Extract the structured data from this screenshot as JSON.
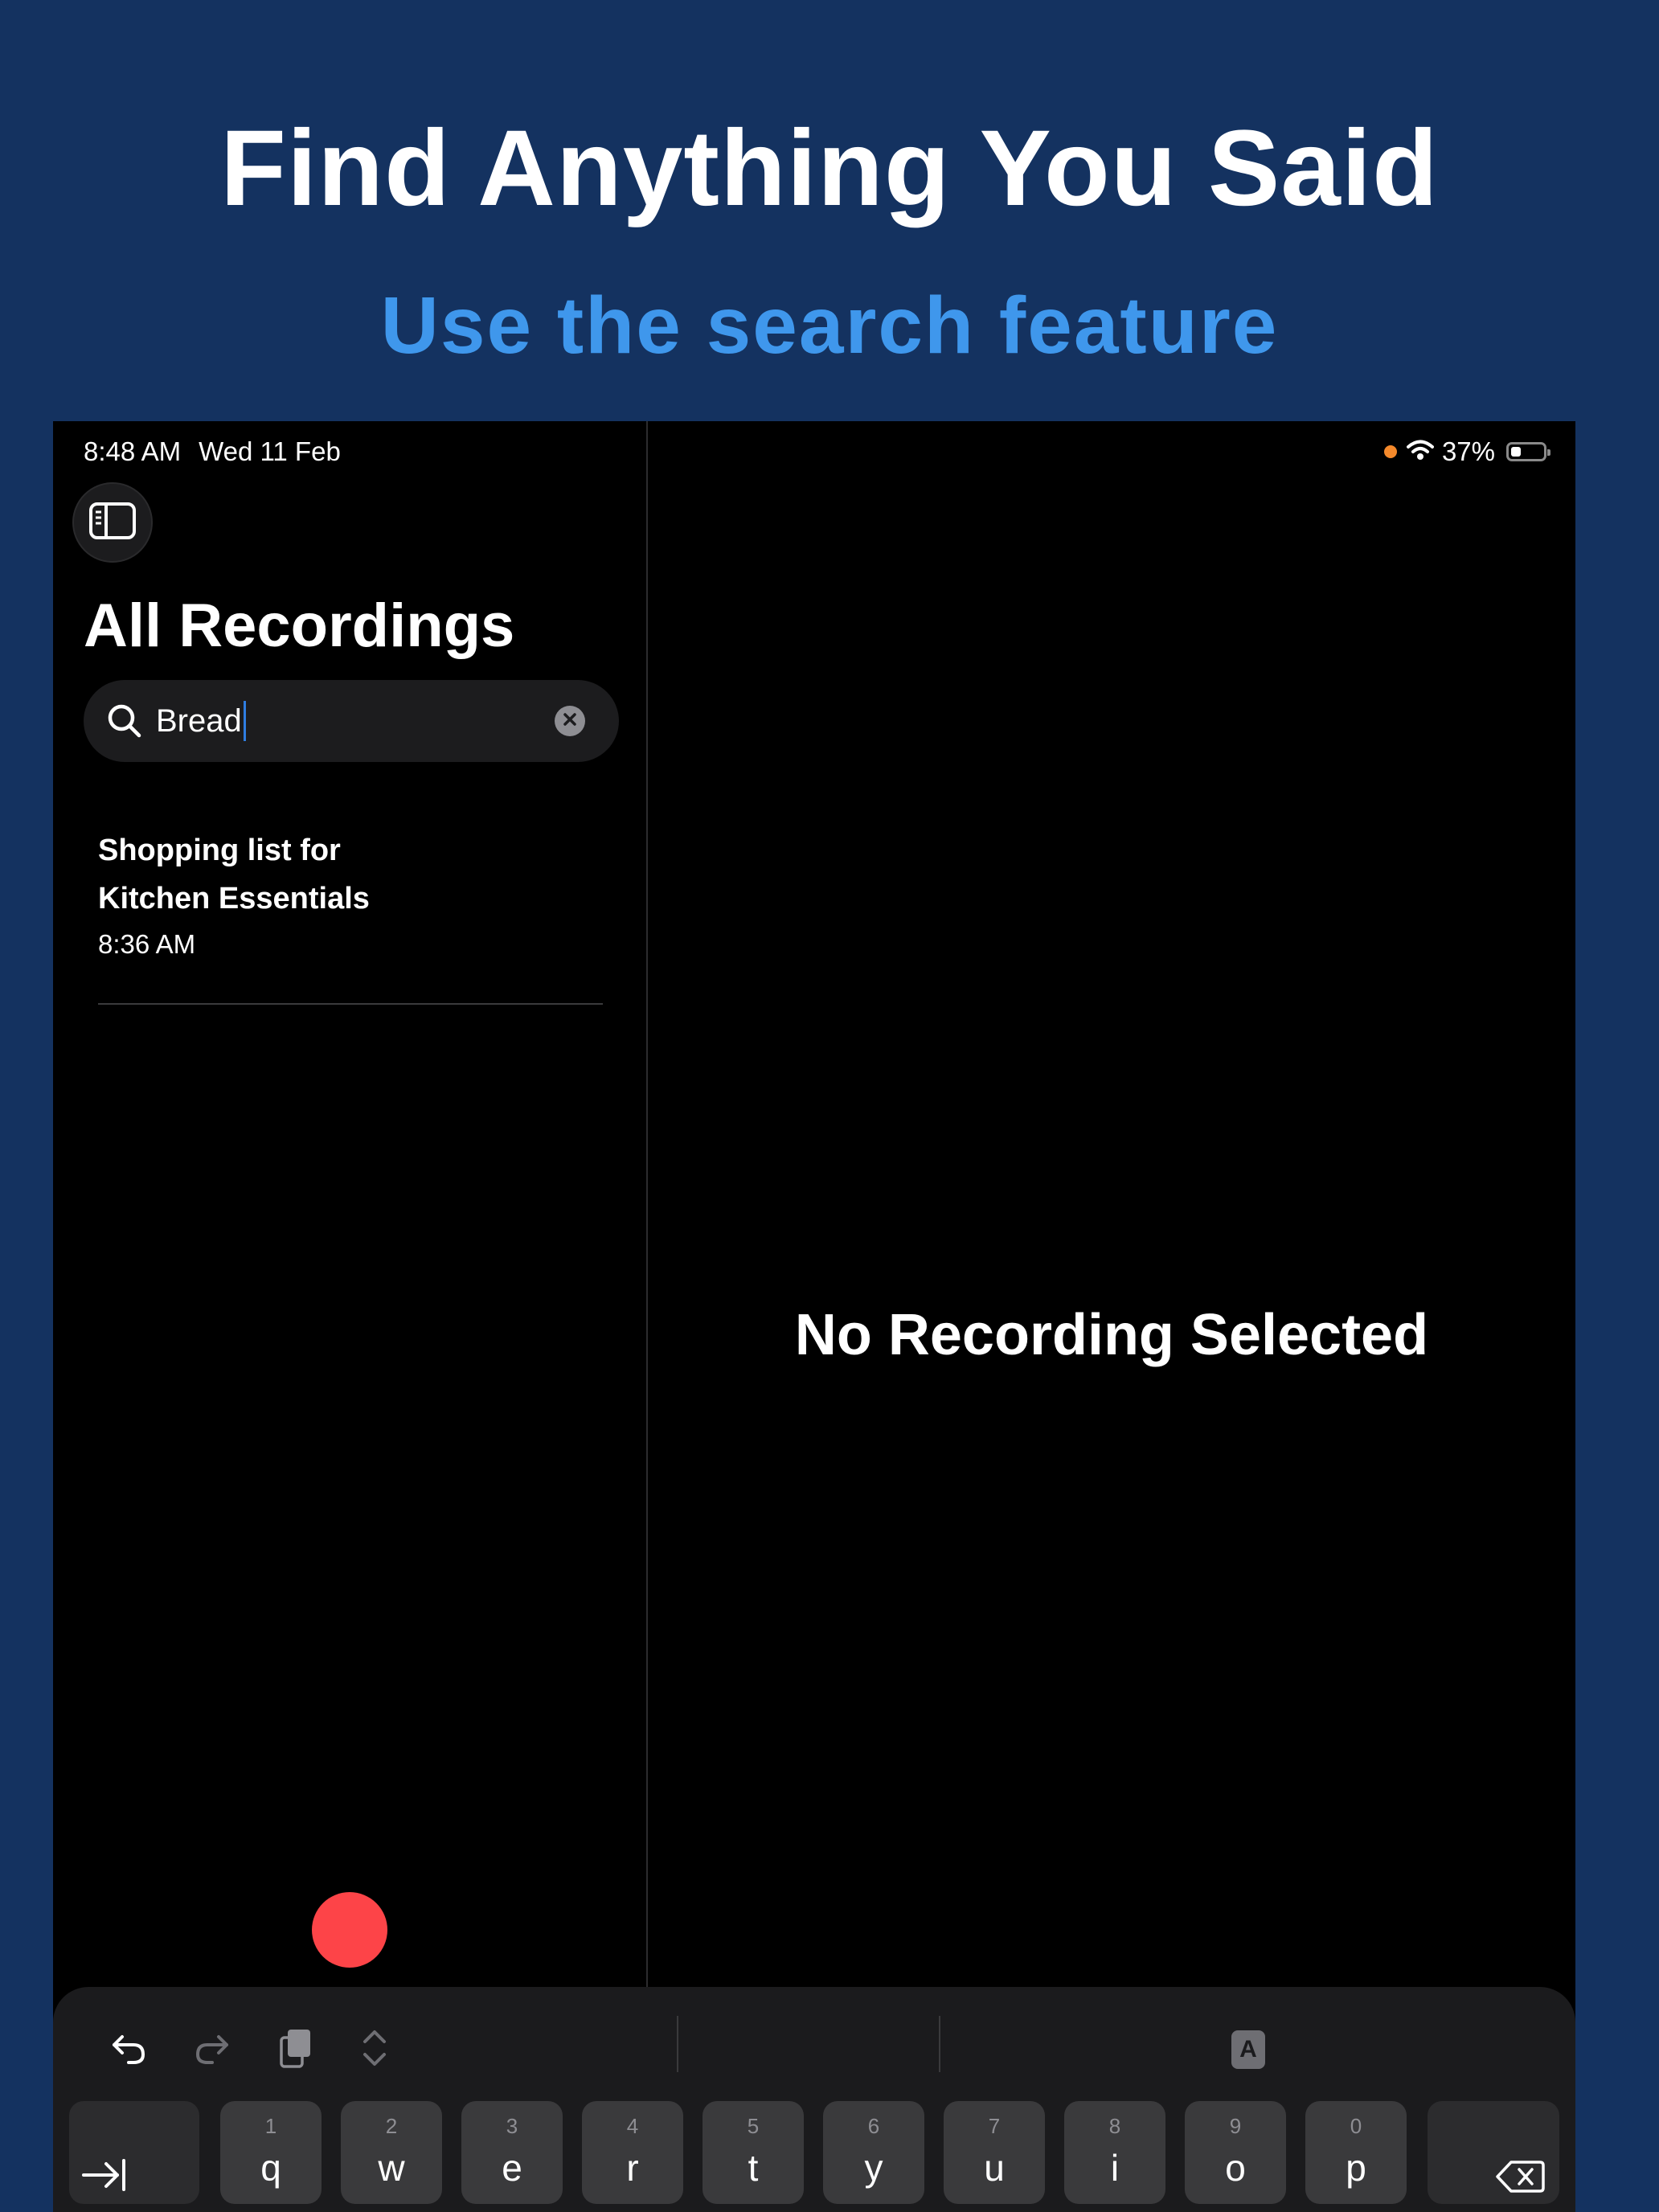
{
  "promo": {
    "headline": "Find Anything You Said",
    "subheadline": "Use the search feature"
  },
  "status_bar": {
    "time": "8:48 AM",
    "date": "Wed 11 Feb",
    "battery": "37%"
  },
  "sidebar": {
    "title": "All Recordings",
    "search": {
      "value": "Bread"
    },
    "results": [
      {
        "title": "Shopping list for Kitchen Essentials",
        "time": "8:36 AM"
      }
    ]
  },
  "detail": {
    "empty_state": "No Recording Selected"
  },
  "keyboard": {
    "format_label": "A",
    "keys": [
      {
        "num": "1",
        "letter": "q"
      },
      {
        "num": "2",
        "letter": "w"
      },
      {
        "num": "3",
        "letter": "e"
      },
      {
        "num": "4",
        "letter": "r"
      },
      {
        "num": "5",
        "letter": "t"
      },
      {
        "num": "6",
        "letter": "y"
      },
      {
        "num": "7",
        "letter": "u"
      },
      {
        "num": "8",
        "letter": "i"
      },
      {
        "num": "9",
        "letter": "o"
      },
      {
        "num": "0",
        "letter": "p"
      }
    ]
  },
  "colors": {
    "background": "#143260",
    "accent": "#3f97ec",
    "record": "#fd4448"
  }
}
